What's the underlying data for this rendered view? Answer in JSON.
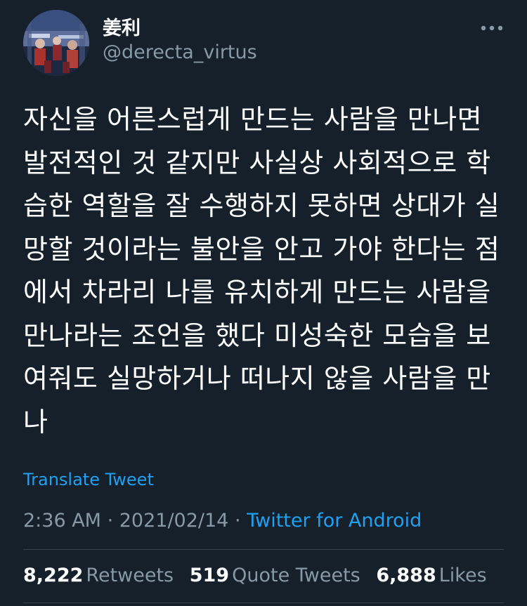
{
  "author": {
    "display_name": "姜利",
    "handle": "@derecta_virtus",
    "avatar_icon": "avatar-photo"
  },
  "tweet": {
    "lines": [
      "자신을 어른스럽게 만드는 사람을 만나면",
      "발전적인 것 같지만 사실상 사회적으로 학",
      "습한 역할을 잘 수행하지 못하면 상대가 실",
      "망할 것이라는 불안을 안고 가야 한다는 점",
      "에서 차라리 나를 유치하게 만드는 사람을",
      "만나라는 조언을 했다 미성숙한 모습을 보",
      "여줘도 실망하거나 떠나지 않을 사람을 만",
      "나"
    ]
  },
  "translate_label": "Translate Tweet",
  "meta": {
    "time": "2:36 AM",
    "separator1": " · ",
    "date": "2021/02/14",
    "separator2": " · ",
    "source": "Twitter for Android"
  },
  "stats": {
    "retweets_count": "8,222",
    "retweets_label": "Retweets",
    "quote_count": "519",
    "quote_label": "Quote Tweets",
    "likes_count": "6,888",
    "likes_label": "Likes"
  },
  "colors": {
    "background": "#15202b",
    "accent": "#1da1f2",
    "secondary_text": "#8899a6",
    "divider": "#38444d"
  }
}
